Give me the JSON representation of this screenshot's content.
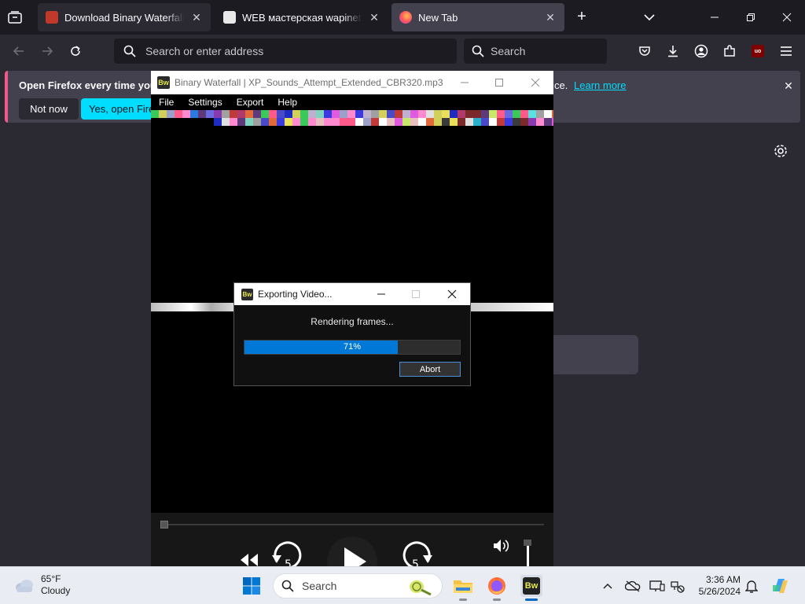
{
  "browser": {
    "tabs": [
      {
        "title": "Download Binary Waterfall (W",
        "favicon": "binary-waterfall-favicon",
        "state": "inactive"
      },
      {
        "title": "WEB мастерская wapinet.ru - ",
        "favicon": "wapinet-favicon",
        "state": "inactive"
      },
      {
        "title": "New Tab",
        "favicon": "firefox-favicon",
        "state": "active"
      }
    ],
    "url_placeholder": "Search or enter address",
    "search_placeholder": "Search",
    "extension_badge": "uo"
  },
  "notification": {
    "message": "Open Firefox every time you re",
    "message_tail": "ce.",
    "not_now": "Not now",
    "yes_open": "Yes, open Firefox",
    "learn_more": "Learn more"
  },
  "app": {
    "title": "Binary Waterfall | XP_Sounds_Attempt_Extended_CBR320.mp3",
    "icon_label": "Bw",
    "menu": [
      "File",
      "Settings",
      "Export",
      "Help"
    ],
    "dialog": {
      "title": "Exporting Video...",
      "status": "Rendering frames...",
      "progress": 0.71,
      "progress_label": "71%",
      "abort": "Abort"
    }
  },
  "taskbar": {
    "weather_temp": "65°F",
    "weather_desc": "Cloudy",
    "search_placeholder": "Search",
    "time": "3:36 AM",
    "date": "5/26/2024"
  },
  "colors": {
    "accent": "#00ddff",
    "progress": "#0078d7",
    "tab_active": "#42414d"
  }
}
